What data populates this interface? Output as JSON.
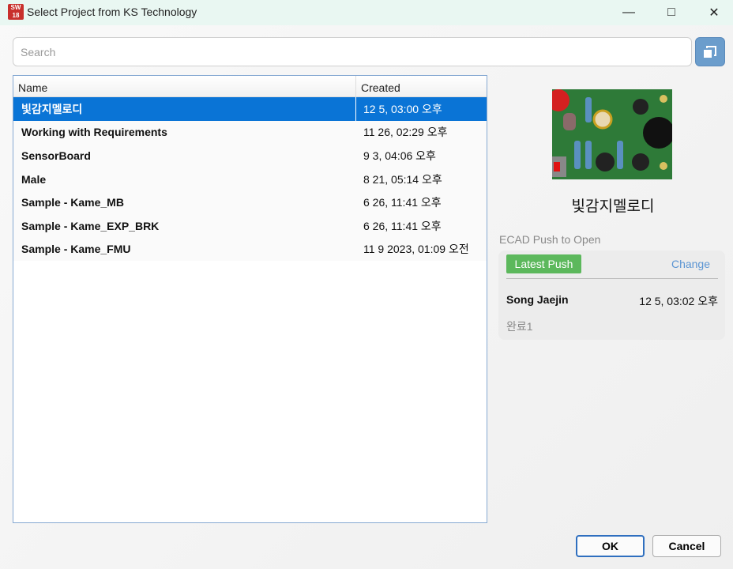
{
  "window": {
    "title": "Select Project from KS Technology",
    "app_icon": "SW 2018"
  },
  "search": {
    "placeholder": "Search",
    "value": ""
  },
  "table": {
    "columns": [
      "Name",
      "Created"
    ],
    "rows": [
      {
        "name": "빛감지멜로디",
        "created": "12 5, 03:00 오후",
        "selected": true
      },
      {
        "name": "Working with Requirements",
        "created": "11 26, 02:29 오후"
      },
      {
        "name": "SensorBoard",
        "created": "9 3, 04:06 오후"
      },
      {
        "name": "Male",
        "created": "8 21, 05:14 오후"
      },
      {
        "name": "Sample - Kame_MB",
        "created": "6 26, 11:41 오후"
      },
      {
        "name": "Sample - Kame_EXP_BRK",
        "created": "6 26, 11:41 오후"
      },
      {
        "name": "Sample - Kame_FMU",
        "created": "11 9 2023, 01:09 오전"
      }
    ]
  },
  "preview": {
    "title": "빛감지멜로디",
    "section_label": "ECAD Push to Open",
    "latest_push": "Latest Push",
    "change": "Change",
    "user": "Song Jaejin",
    "date": "12 5, 03:02 오후",
    "message": "완료1"
  },
  "buttons": {
    "ok": "OK",
    "cancel": "Cancel"
  },
  "colors": {
    "accent": "#0a74d6",
    "push": "#5cb85c",
    "link": "#5b95d3"
  }
}
